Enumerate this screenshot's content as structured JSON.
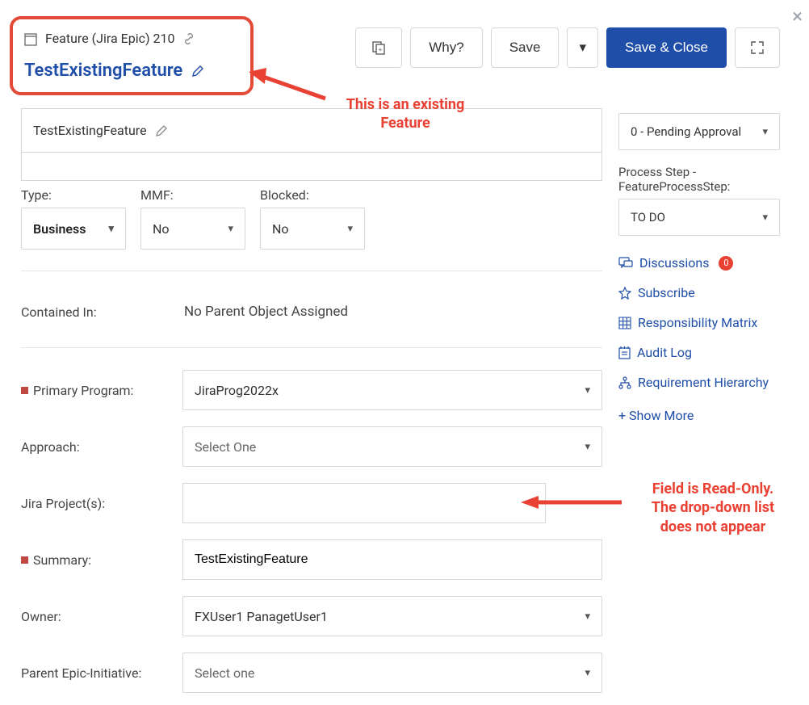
{
  "header": {
    "type_label": "Feature (Jira Epic) 210",
    "title": "TestExistingFeature"
  },
  "toolbar": {
    "why": "Why?",
    "save": "Save",
    "save_close": "Save & Close"
  },
  "annotations": {
    "existing_feature": "This is an existing\nFeature",
    "readonly_field": "Field is Read-Only.\nThe drop-down list\ndoes not appear"
  },
  "name_field": {
    "value": "TestExistingFeature"
  },
  "type_row": {
    "type_label": "Type:",
    "type_value": "Business",
    "mmf_label": "MMF:",
    "mmf_value": "No",
    "blocked_label": "Blocked:",
    "blocked_value": "No"
  },
  "fields": {
    "contained_in": {
      "label": "Contained In:",
      "value": "No Parent Object Assigned"
    },
    "primary_program": {
      "label": "Primary Program:",
      "value": "JiraProg2022x"
    },
    "approach": {
      "label": "Approach:",
      "placeholder": "Select One"
    },
    "jira_projects": {
      "label": "Jira Project(s):"
    },
    "summary": {
      "label": "Summary:",
      "value": "TestExistingFeature"
    },
    "owner": {
      "label": "Owner:",
      "value": "FXUser1 PanagetUser1"
    },
    "parent_epic": {
      "label": "Parent Epic-Initiative:",
      "placeholder": "Select one"
    }
  },
  "sidebar": {
    "status": {
      "value": "0 - Pending Approval"
    },
    "process_label": "Process Step - FeatureProcessStep:",
    "process_value": "TO DO",
    "links": {
      "discussions": "Discussions",
      "discussions_count": "0",
      "subscribe": "Subscribe",
      "resp_matrix": "Responsibility Matrix",
      "audit_log": "Audit Log",
      "req_hierarchy": "Requirement Hierarchy",
      "show_more": "+ Show More"
    }
  }
}
